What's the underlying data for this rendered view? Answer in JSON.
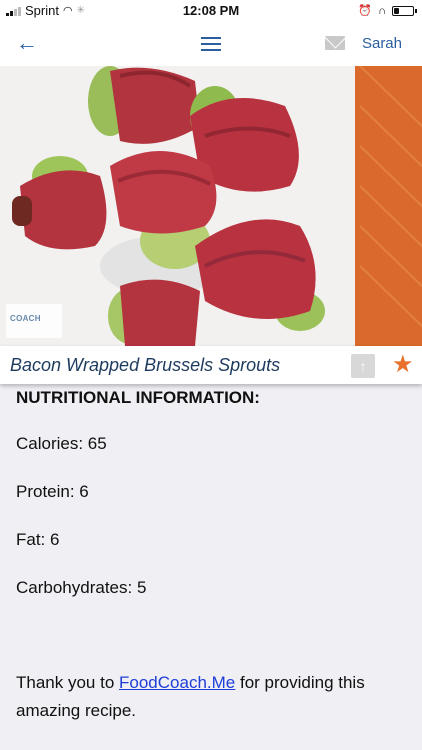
{
  "status_bar": {
    "carrier": "Sprint",
    "time": "12:08 PM"
  },
  "nav": {
    "back_icon": "←",
    "user_name": "Sarah"
  },
  "hero": {
    "watermark_text": "COACH"
  },
  "recipe": {
    "title": "Bacon Wrapped Brussels Sprouts",
    "is_favorite": true,
    "accent_color": "#e8702a"
  },
  "nutrition": {
    "heading": "NUTRITIONAL INFORMATION:",
    "items": [
      "Calories: 65",
      "Protein: 6",
      "Fat: 6",
      "Carbohydrates: 5"
    ]
  },
  "thanks": {
    "prefix": "Thank you to ",
    "link_text": "FoodCoach.Me",
    "suffix": " for providing this amazing recipe."
  }
}
